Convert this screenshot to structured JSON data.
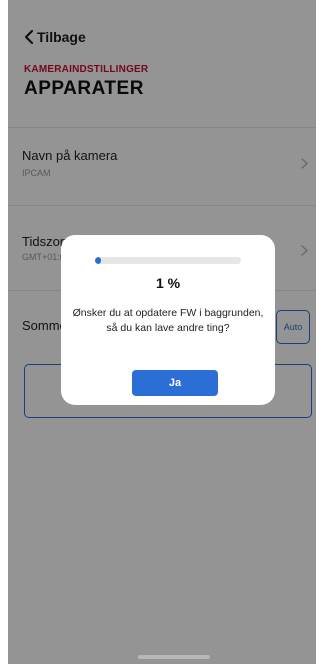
{
  "header": {
    "back_label": "Tilbage",
    "back_icon": "chevron-left-icon",
    "section_kicker": "KAMERAINDSTILLINGER",
    "title": "APPARATER"
  },
  "settings": {
    "camera_name": {
      "label": "Navn på kamera",
      "value": "IPCAM"
    },
    "timezone": {
      "label": "Tidszone",
      "value": "GMT+01:00"
    },
    "sleep": {
      "label": "Sommer",
      "auto_label": "Auto"
    }
  },
  "dialog": {
    "progress_percent": 1,
    "progress_text": "1 %",
    "message": "Ønsker du at opdatere FW i baggrunden, så du kan lave andre ting?",
    "confirm_label": "Ja"
  },
  "colors": {
    "accent": "#2b6fd6",
    "kicker_red": "#c8102e",
    "overlay": "rgba(0,0,0,0.42)"
  }
}
